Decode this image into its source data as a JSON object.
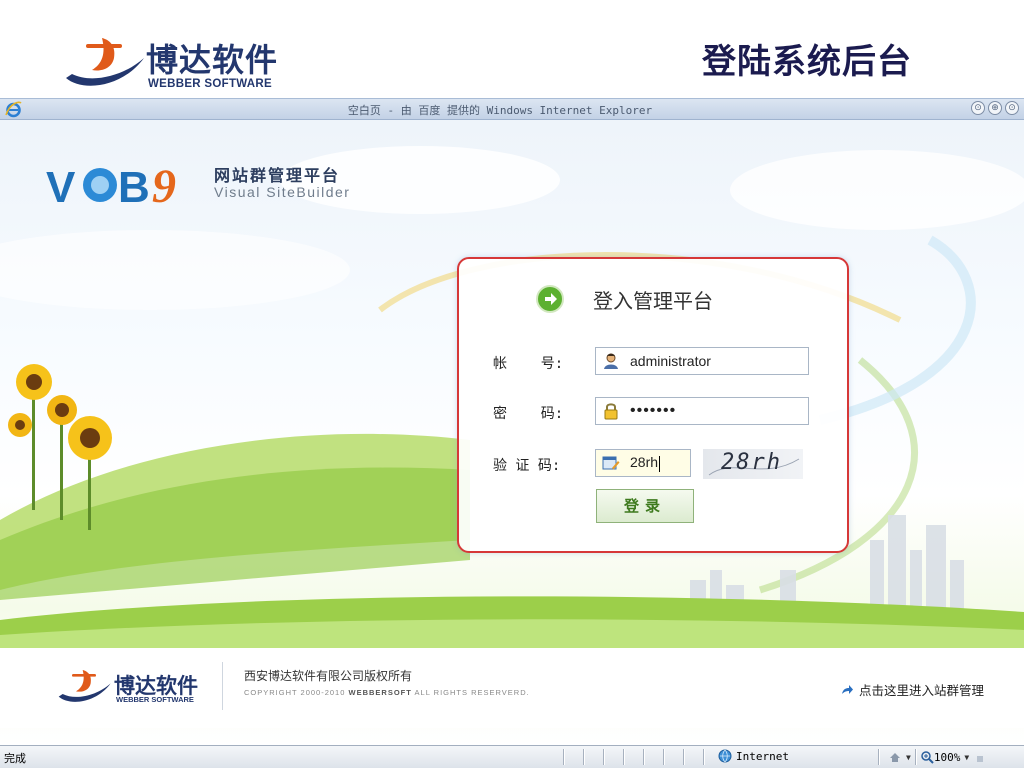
{
  "slide": {
    "title": "登陆系统后台",
    "company_logo": {
      "name_cn": "博达软件",
      "name_en": "WEBBER SOFTWARE"
    }
  },
  "browser": {
    "window_title": "空白页 - 由 百度 提供的 Windows Internet Explorer",
    "controls": [
      "⊙",
      "⊕",
      "⊙"
    ],
    "status_text": "完成",
    "zone": "Internet",
    "zoom": "100%"
  },
  "page": {
    "product_logo": {
      "cn": "网站群管理平台",
      "en": "Visual  SiteBuilder"
    },
    "login": {
      "heading": "登入管理平台",
      "account_label": "帐    号:",
      "account_value": "administrator",
      "password_label": "密    码:",
      "password_value": "•••••••",
      "captcha_label": "验 证 码:",
      "captcha_value": "28rh",
      "captcha_image_text": "28rh",
      "submit_label": "登录"
    },
    "footer": {
      "logo": {
        "name_cn": "博达软件",
        "name_en": "WEBBER SOFTWARE"
      },
      "copyright_cn": "西安博达软件有限公司版权所有",
      "copyright_en_prefix": "COPYRIGHT 2000-2010",
      "copyright_en_brand": "WEBBERSOFT",
      "copyright_en_suffix": "ALL RIGHTS RESERVERD.",
      "enter_link": "点击这里进入站群管理"
    }
  },
  "colors": {
    "brand_navy": "#23376e",
    "panel_border": "#d63838",
    "button_green": "#3e7a1e"
  }
}
